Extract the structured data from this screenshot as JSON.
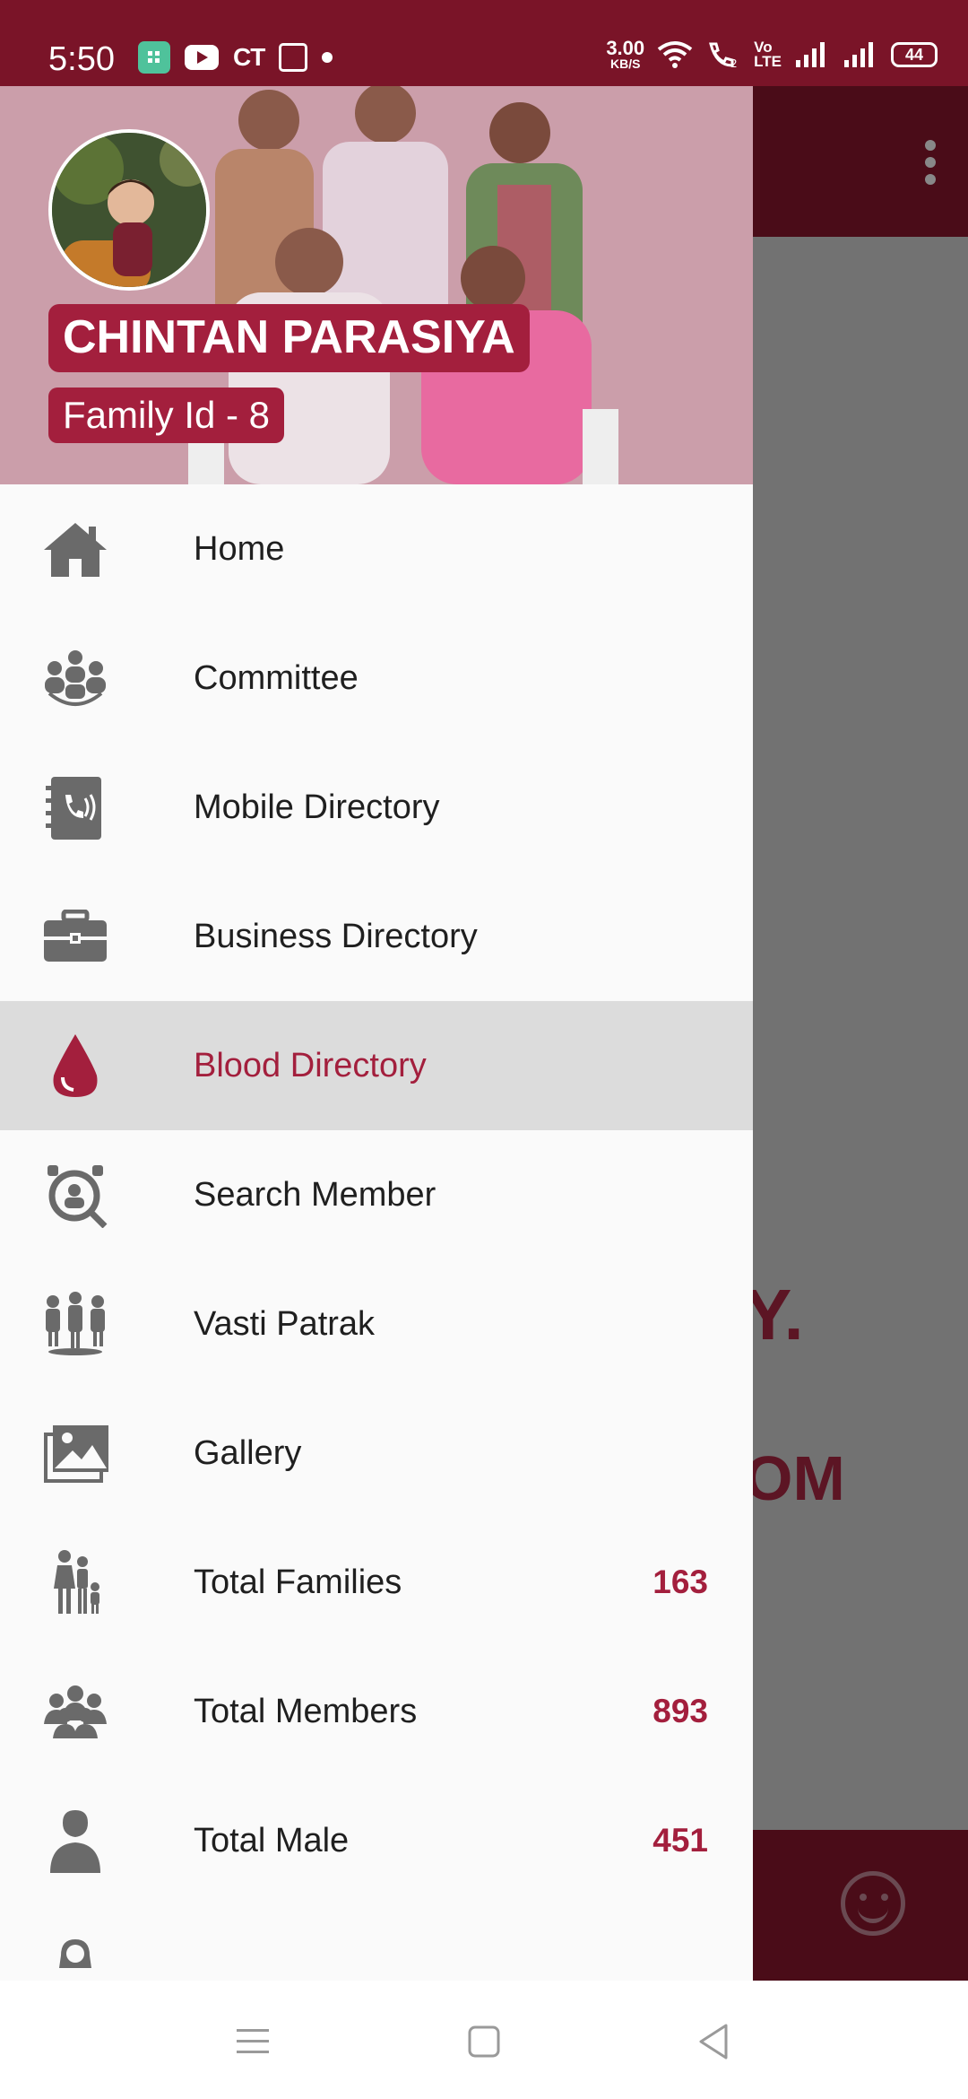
{
  "status_bar": {
    "time": "5:50",
    "app_icons": [
      "app-icon",
      "youtube-icon",
      "CT",
      "gallery-icon"
    ],
    "net_speed_value": "3.00",
    "net_speed_unit": "KB/S",
    "volte_label": "Vo\nLTE",
    "battery": "44"
  },
  "drawer": {
    "user_name": "CHINTAN PARASIYA",
    "family_id": "Family Id - 8",
    "menu_items": [
      {
        "label": "Home",
        "icon": "home-icon",
        "count": ""
      },
      {
        "label": "Committee",
        "icon": "committee-icon",
        "count": ""
      },
      {
        "label": "Mobile Directory",
        "icon": "phonebook-icon",
        "count": ""
      },
      {
        "label": "Business Directory",
        "icon": "briefcase-icon",
        "count": ""
      },
      {
        "label": "Blood Directory",
        "icon": "blood-drop-icon",
        "count": "",
        "active": true
      },
      {
        "label": "Search Member",
        "icon": "search-member-icon",
        "count": ""
      },
      {
        "label": "Vasti Patrak",
        "icon": "people-group-icon",
        "count": ""
      },
      {
        "label": "Gallery",
        "icon": "gallery-icon",
        "count": ""
      },
      {
        "label": "Total Families",
        "icon": "family-icon",
        "count": "163"
      },
      {
        "label": "Total Members",
        "icon": "members-icon",
        "count": "893"
      },
      {
        "label": "Total Male",
        "icon": "male-icon",
        "count": "451"
      }
    ],
    "accent_color": "#a31f3d"
  },
  "background_app": {
    "partial_text_1": "Y.",
    "partial_text_2": "OM"
  },
  "nav_bar": {
    "buttons": [
      "menu-icon",
      "home-square-icon",
      "back-triangle-icon"
    ]
  }
}
